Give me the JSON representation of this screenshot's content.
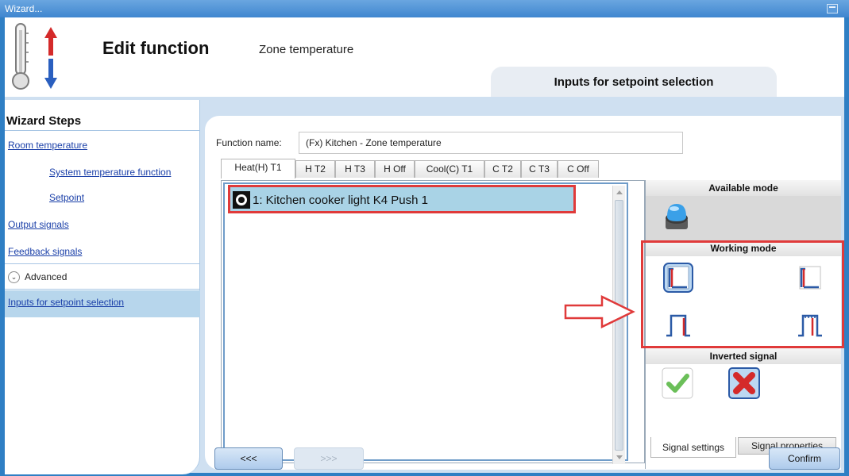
{
  "window": {
    "title": "Wizard..."
  },
  "header": {
    "title": "Edit function",
    "subtitle": "Zone temperature",
    "step_tab": "Inputs for setpoint selection"
  },
  "sidebar": {
    "heading": "Wizard Steps",
    "items": [
      {
        "label": "Room temperature"
      },
      {
        "label": "System temperature function"
      },
      {
        "label": "Setpoint"
      },
      {
        "label": "Output signals"
      },
      {
        "label": "Feedback signals"
      },
      {
        "label": "Advanced"
      },
      {
        "label": "Inputs for setpoint selection"
      }
    ]
  },
  "function_name": {
    "label": "Function name:",
    "value": "(Fx) Kitchen - Zone temperature"
  },
  "tabs": [
    {
      "label": "Heat(H) T1"
    },
    {
      "label": "H T2"
    },
    {
      "label": "H T3"
    },
    {
      "label": "H Off"
    },
    {
      "label": "Cool(C) T1"
    },
    {
      "label": "C T2"
    },
    {
      "label": "C T3"
    },
    {
      "label": "C Off"
    }
  ],
  "inputs_list": [
    {
      "label": "1: Kitchen cooker light K4 Push 1"
    }
  ],
  "right_panel": {
    "available_mode": "Available mode",
    "working_mode": "Working mode",
    "inverted_signal": "Inverted signal",
    "tab_settings": "Signal settings",
    "tab_properties": "Signal properties"
  },
  "buttons": {
    "back": "<<<",
    "next": ">>>",
    "confirm": "Confirm"
  },
  "colors": {
    "title_bar": "#3f86cf",
    "highlight_red": "#e03a3a",
    "selected_row": "#a9d3e6",
    "sidebar_active": "#b7d6ec"
  }
}
